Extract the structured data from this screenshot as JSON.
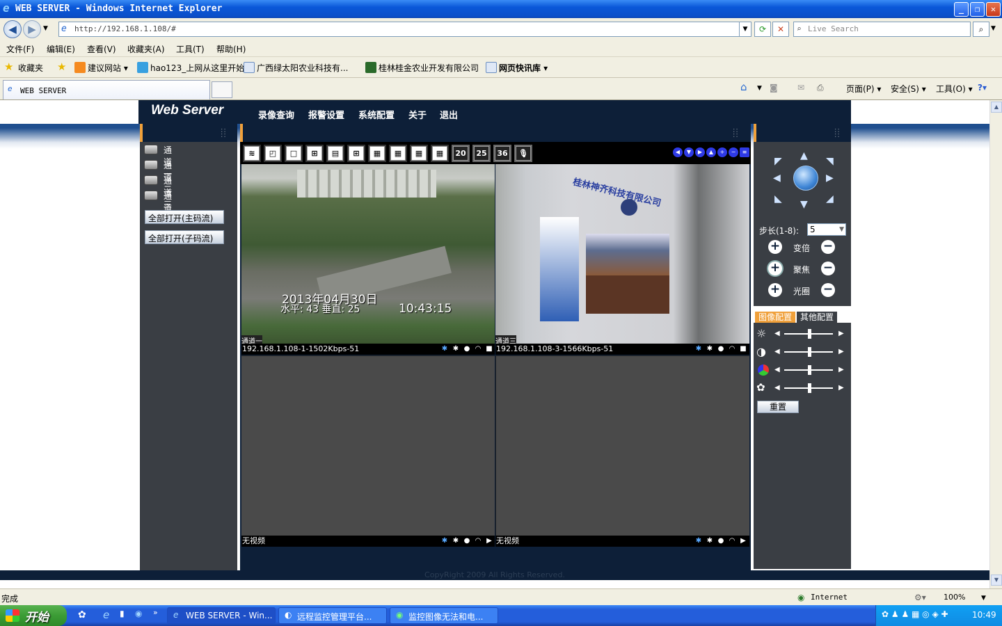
{
  "window": {
    "title": "WEB SERVER - Windows Internet Explorer"
  },
  "address": {
    "url": "http://192.168.1.108/#",
    "search_placeholder": "Live Search"
  },
  "menu": [
    "文件(F)",
    "编辑(E)",
    "查看(V)",
    "收藏夹(A)",
    "工具(T)",
    "帮助(H)"
  ],
  "favorites": {
    "label": "收藏夹",
    "items": [
      "建议网站 ▾",
      "hao123_上网从这里开始",
      "广西绿太阳农业科技有...",
      "桂林桂金农业开发有限公司",
      "网页快讯库 ▾"
    ]
  },
  "tab": {
    "title": "WEB SERVER"
  },
  "cmdbar": {
    "page": "页面(P) ▾",
    "safety": "安全(S) ▾",
    "tools": "工具(O) ▾"
  },
  "app": {
    "logo": "Web Server",
    "nav": [
      "录像查询",
      "报警设置",
      "系统配置",
      "关于",
      "退出"
    ],
    "channels": [
      "通道一",
      "通道二",
      "通道三",
      "通道四"
    ],
    "open_main": "全部打开(主码流)",
    "open_sub": "全部打开(子码流)",
    "toolbar_numbers": [
      "20",
      "25",
      "36"
    ],
    "videos": [
      {
        "label": "192.168.1.108-1-1502Kbps-51",
        "tag": "通道一",
        "date": "2013年04月30日",
        "pos": "水平: 43 垂直: 25",
        "time": "10:43:15"
      },
      {
        "label": "192.168.1.108-3-1566Kbps-51",
        "tag": "通道三",
        "sign": "桂林神齐科技有限公司"
      },
      {
        "label": "无视频"
      },
      {
        "label": "无视频"
      }
    ],
    "ptz": {
      "step_label": "步长(1-8):",
      "step_value": "5",
      "zoom": "变倍",
      "focus": "聚焦",
      "iris": "光圈"
    },
    "tabs": [
      "图像配置",
      "其他配置"
    ],
    "reset": "重置",
    "copyright": "CopyRight 2009 All Rights Reserved."
  },
  "status": {
    "left": "完成",
    "zone": "Internet",
    "zoom": "100%"
  },
  "taskbar": {
    "start": "开始",
    "items": [
      "WEB SERVER - Win...",
      "远程监控管理平台...",
      "监控图像无法和电..."
    ],
    "clock": "10:49"
  }
}
